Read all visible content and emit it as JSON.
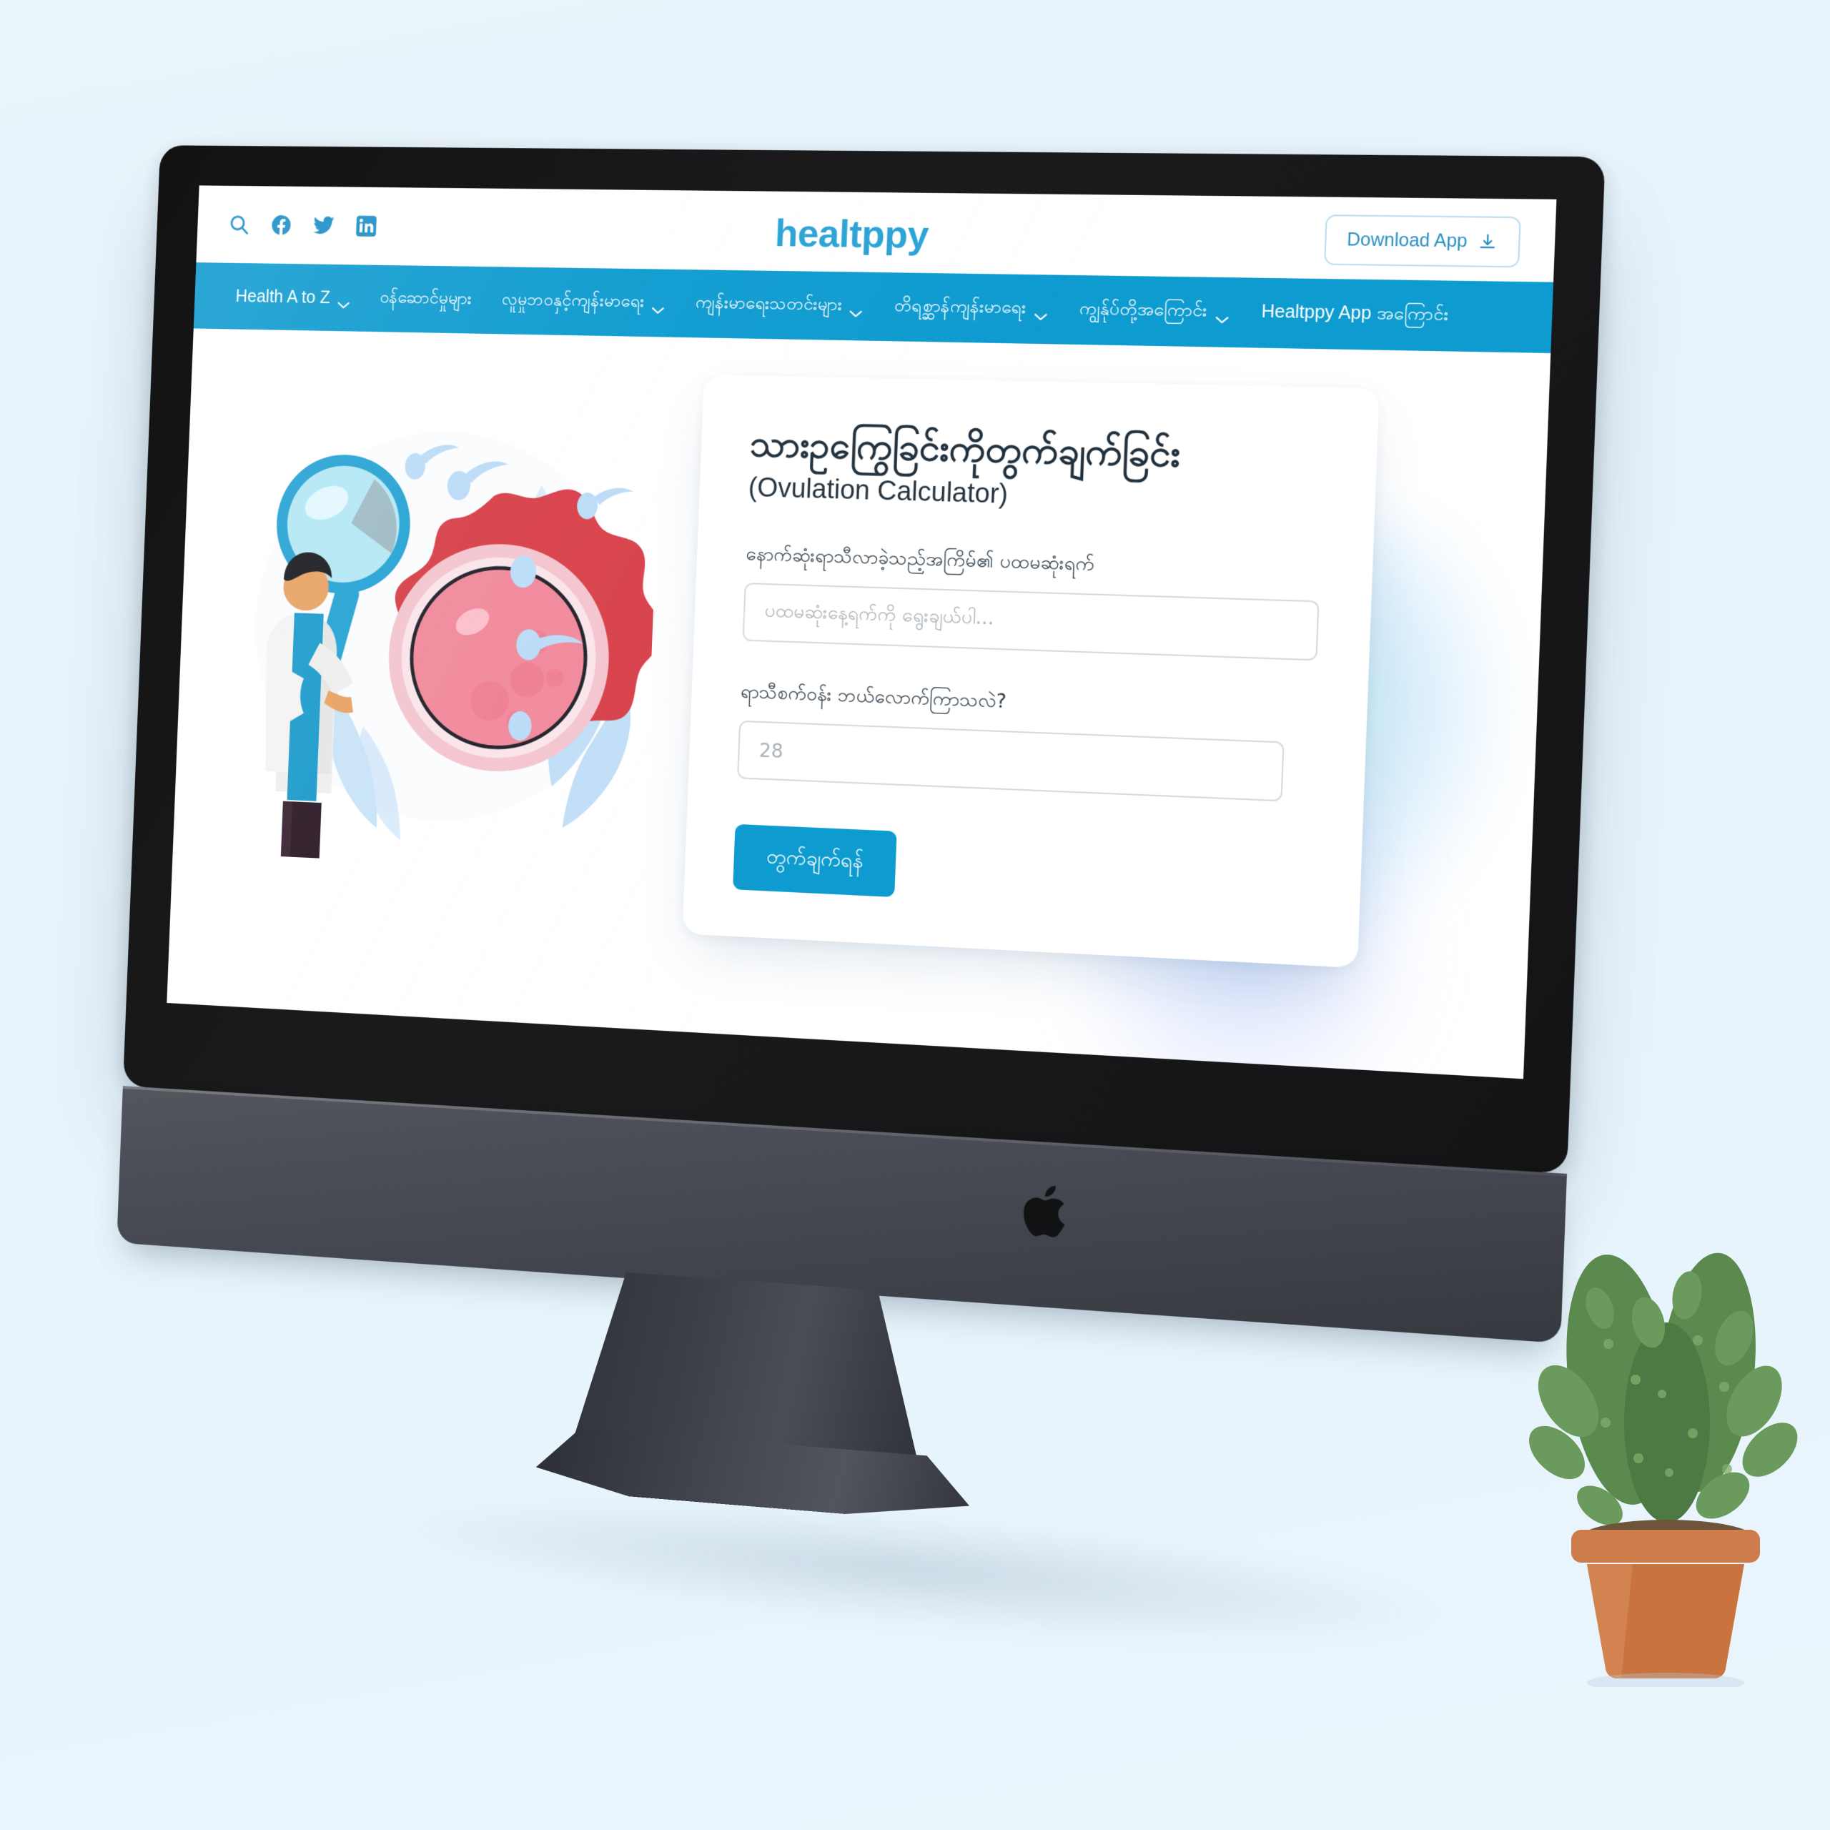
{
  "header": {
    "brand": "healtppy",
    "download_label": "Download App",
    "social": [
      {
        "name": "search-icon",
        "label": "Search"
      },
      {
        "name": "facebook-icon",
        "label": "Facebook"
      },
      {
        "name": "twitter-icon",
        "label": "Twitter"
      },
      {
        "name": "linkedin-icon",
        "label": "LinkedIn"
      }
    ]
  },
  "nav": {
    "accent_color": "#0e9bd0",
    "items": [
      {
        "label": "Health A to Z",
        "has_dropdown": true
      },
      {
        "label": "ဝန်ဆောင်မှုများ",
        "has_dropdown": false
      },
      {
        "label": "လူမှုဘဝနှင့်ကျန်းမာရေး",
        "has_dropdown": true
      },
      {
        "label": "ကျန်းမာရေးသတင်းများ",
        "has_dropdown": true
      },
      {
        "label": "တိရစ္ဆာန်ကျန်းမာရေး",
        "has_dropdown": true
      },
      {
        "label": "ကျွန်ုပ်တို့အကြောင်း",
        "has_dropdown": true
      },
      {
        "label": "Healtppy App အကြောင်း",
        "has_dropdown": false
      }
    ]
  },
  "calculator": {
    "title": "သားဥကြွေခြင်းကိုတွက်ချက်ခြင်း",
    "subtitle": "(Ovulation Calculator)",
    "field1": {
      "label": "နောက်ဆုံးရာသီလာခဲ့သည့်အကြိမ်၏ ပထမဆုံးရက်",
      "value": "",
      "placeholder": "ပထမဆုံးနေ့ရက်ကို ရွေးချယ်ပါ..."
    },
    "field2": {
      "label": "ရာသီစက်ဝန်း ဘယ်လောက်ကြာသလဲ?",
      "value": "",
      "placeholder": "28"
    },
    "submit_label": "တွက်ချက်ရန်"
  },
  "illustration": {
    "name": "doctor-examining-ovum-illustration",
    "alt": "Doctor in white coat holding magnifying glass examining an egg cell with sperm cells"
  },
  "device": {
    "name": "imac-space-gray",
    "logo": "apple-logo"
  },
  "decor": {
    "plant": "cactus-in-terracotta-pot"
  }
}
